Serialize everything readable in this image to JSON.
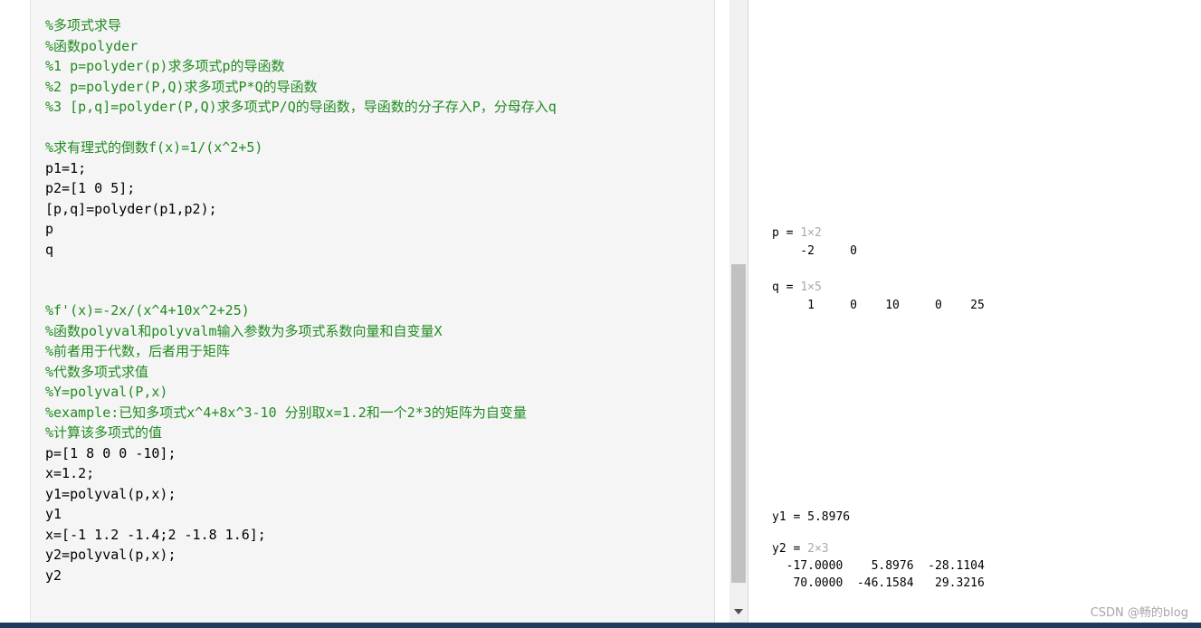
{
  "editor": {
    "lines": [
      {
        "text": "%多项式求导",
        "comment": true
      },
      {
        "text": "%函数polyder",
        "comment": true
      },
      {
        "text": "%1 p=polyder(p)求多项式p的导函数",
        "comment": true
      },
      {
        "text": "%2 p=polyder(P,Q)求多项式P*Q的导函数",
        "comment": true
      },
      {
        "text": "%3 [p,q]=polyder(P,Q)求多项式P/Q的导函数，导函数的分子存入P，分母存入q",
        "comment": true
      },
      {
        "text": "",
        "comment": false
      },
      {
        "text": "%求有理式的倒数f(x)=1/(x^2+5)",
        "comment": true
      },
      {
        "text": "p1=1;",
        "comment": false
      },
      {
        "text": "p2=[1 0 5];",
        "comment": false
      },
      {
        "text": "[p,q]=polyder(p1,p2);",
        "comment": false
      },
      {
        "text": "p",
        "comment": false
      },
      {
        "text": "q",
        "comment": false
      },
      {
        "text": "",
        "comment": false
      },
      {
        "text": "",
        "comment": false
      },
      {
        "text": "%f'(x)=-2x/(x^4+10x^2+25)",
        "comment": true
      },
      {
        "text": "%函数polyval和polyvalm输入参数为多项式系数向量和自变量X",
        "comment": true
      },
      {
        "text": "%前者用于代数，后者用于矩阵",
        "comment": true
      },
      {
        "text": "%代数多项式求值",
        "comment": true
      },
      {
        "text": "%Y=polyval(P,x)",
        "comment": true
      },
      {
        "text": "%example:已知多项式x^4+8x^3-10 分别取x=1.2和一个2*3的矩阵为自变量",
        "comment": true
      },
      {
        "text": "%计算该多项式的值",
        "comment": true
      },
      {
        "text": "p=[1 8 0 0 -10];",
        "comment": false
      },
      {
        "text": "x=1.2;",
        "comment": false
      },
      {
        "text": "y1=polyval(p,x);",
        "comment": false
      },
      {
        "text": "y1",
        "comment": false
      },
      {
        "text": "x=[-1 1.2 -1.4;2 -1.8 1.6];",
        "comment": false
      },
      {
        "text": "y2=polyval(p,x);",
        "comment": false
      },
      {
        "text": "y2",
        "comment": false
      }
    ]
  },
  "output": {
    "p": {
      "label": "p = ",
      "size": "1×2",
      "rows": [
        "    -2     0"
      ]
    },
    "q": {
      "label": "q = ",
      "size": "1×5",
      "rows": [
        "     1     0    10     0    25"
      ]
    },
    "y1": {
      "label": "y1 = 5.8976"
    },
    "y2": {
      "label": "y2 = ",
      "size": "2×3",
      "rows": [
        "  -17.0000    5.8976  -28.1104",
        "   70.0000  -46.1584   29.3216"
      ]
    }
  },
  "watermark": "CSDN @畅的blog",
  "scrollbar": {
    "thumb_position_fraction": 0.42
  }
}
